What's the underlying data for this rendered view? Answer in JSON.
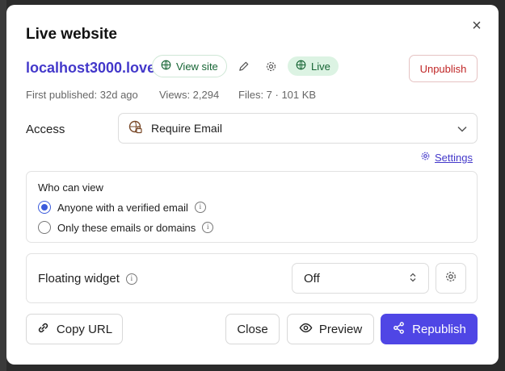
{
  "dialog": {
    "title": "Live website",
    "close_glyph": "×"
  },
  "site": {
    "url_label": "localhost3000.love",
    "view_site_label": "View site",
    "status_label": "Live",
    "unpublish_label": "Unpublish",
    "first_published": "First published: 32d ago",
    "views": "Views: 2,294",
    "files": "Files: 7 · 101 KB"
  },
  "access": {
    "label": "Access",
    "selected": "Require Email",
    "settings_link": "Settings"
  },
  "who_can_view": {
    "title": "Who can view",
    "options": [
      {
        "label": "Anyone with a verified email",
        "selected": true
      },
      {
        "label": "Only these emails or domains",
        "selected": false
      }
    ]
  },
  "floating_widget": {
    "label": "Floating widget",
    "selected": "Off"
  },
  "footer": {
    "copy_url_label": "Copy URL",
    "close_label": "Close",
    "preview_label": "Preview",
    "republish_label": "Republish"
  },
  "colors": {
    "accent": "#4f46e5",
    "link": "#4338ca",
    "live_bg": "#dcf3e3",
    "live_text": "#166534",
    "danger": "#c02626"
  },
  "icons": {
    "close": "close-icon",
    "globe": "globe-icon",
    "pencil": "pencil-icon",
    "gear": "gear-icon",
    "lock_globe": "lock-globe-icon",
    "chevron": "chevron-down-icon",
    "info": "info-icon",
    "link": "link-icon",
    "eye": "eye-icon",
    "share": "share-icon"
  }
}
